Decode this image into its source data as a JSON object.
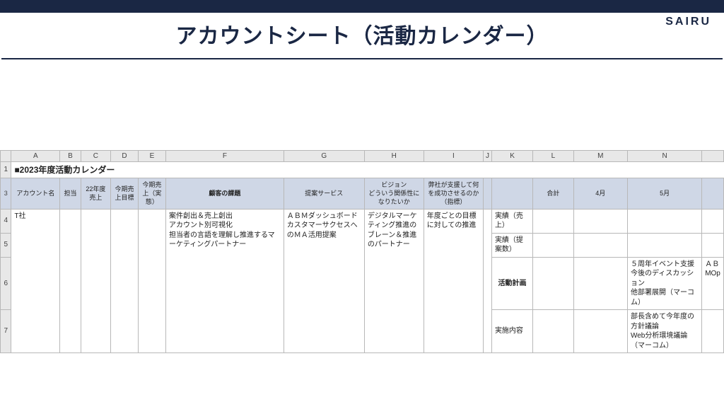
{
  "brand": "SAIRU",
  "page_title": "アカウントシート（活動カレンダー）",
  "columns": [
    "",
    "A",
    "B",
    "C",
    "D",
    "E",
    "F",
    "G",
    "H",
    "I",
    "J",
    "K",
    "L",
    "M",
    "N",
    ""
  ],
  "row_numbers": [
    "1",
    "3",
    "4",
    "5",
    "6",
    "7"
  ],
  "sheet_title": "■2023年度活動カレンダー",
  "headers": {
    "account": "アカウント名",
    "owner": "担当",
    "fy22_rev": "22年度売上",
    "target": "今期売上目標",
    "actual": "今期売上（実態）",
    "issues": "顧客の課題",
    "proposal": "提案サービス",
    "vision": "ビジョン\nどういう関係性になりたいか",
    "kpi": "弊社が支援して何を成功させるのか（指標）",
    "total": "合計",
    "apr": "4月",
    "may": "5月"
  },
  "row": {
    "account": "T社",
    "issues": "案件創出＆売上創出\nアカウント別可視化\n担当者の言語を理解し推進するマーケティングパートナー",
    "proposal": "ＡＢＭダッシュボード\nカスタマーサクセスへのＭＡ活用提案",
    "vision": "デジタルマーケティング推進のブレーン＆推進のパートナー",
    "kpi": "年度ごとの目標に対しての推進"
  },
  "kcol": {
    "r1": "実績（売上）",
    "r2": "実績（提案数）",
    "r3": "活動計画",
    "r4": "実施内容"
  },
  "cells": {
    "may_plan": "５周年イベント支援\n今後のディスカッション\n他部署展開（マーコム）",
    "may_exec": "部長含めて今年度の方針議論\nWeb分析環境議論（マーコム）",
    "o_plan_frag": "ＡＢ\nMOp"
  }
}
